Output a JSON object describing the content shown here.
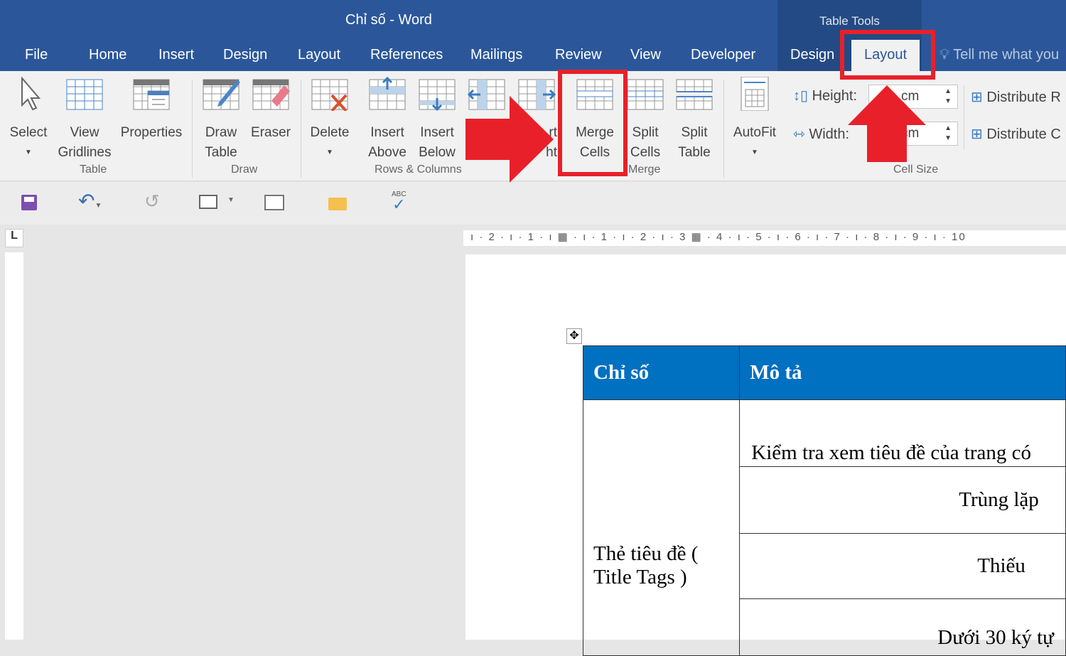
{
  "window": {
    "title": "Chỉ số - Word",
    "context_label": "Table Tools"
  },
  "tabs": [
    "File",
    "Home",
    "Insert",
    "Design",
    "Layout",
    "References",
    "Mailings",
    "Review",
    "View",
    "Developer",
    "Design",
    "Layout"
  ],
  "tell_me": "Tell me what you",
  "ribbon": {
    "groups": {
      "table": "Table",
      "draw": "Draw",
      "rows_columns": "Rows & Columns",
      "merge": "Merge",
      "cell_size": "Cell Size"
    },
    "buttons": {
      "select": "Select",
      "view_gridlines_1": "View",
      "view_gridlines_2": "Gridlines",
      "properties": "Properties",
      "draw_table_1": "Draw",
      "draw_table_2": "Table",
      "eraser": "Eraser",
      "delete": "Delete",
      "insert_above_1": "Insert",
      "insert_above_2": "Above",
      "insert_below_1": "Insert",
      "insert_below_2": "Below",
      "insert_right_1": "rt",
      "insert_right_2": "ht",
      "merge_cells_1": "Merge",
      "merge_cells_2": "Cells",
      "split_cells_1": "Split",
      "split_cells_2": "Cells",
      "split_table_1": "Split",
      "split_table_2": "Table",
      "autofit": "AutoFit",
      "distribute_rows": "Distribute R",
      "distribute_cols": "Distribute C"
    },
    "height_label": "Height:",
    "height_value": "cm",
    "width_label": "Width:",
    "width_value": "cm"
  },
  "ruler": {
    "h": "ı · 2 · ı · 1 · ı ▦ · ı · 1 · ı · 2 · ı · 3 ▦ · 4 · ı · 5 · ı · 6 · ı · 7 · ı · 8 · ı · 9 · ı · 10",
    "corner": "L"
  },
  "table": {
    "headers": [
      "Chỉ số",
      "Mô tả"
    ],
    "row_label": "Thẻ tiêu đề ( Title Tags )",
    "cells": [
      "Kiểm tra xem tiêu đề của trang có",
      "Trùng lặp",
      "Thiếu",
      "Dưới 30 ký tự"
    ]
  },
  "colors": {
    "accent": "#2b579a",
    "table_header": "#0070c0",
    "annotation": "#e8202a"
  }
}
